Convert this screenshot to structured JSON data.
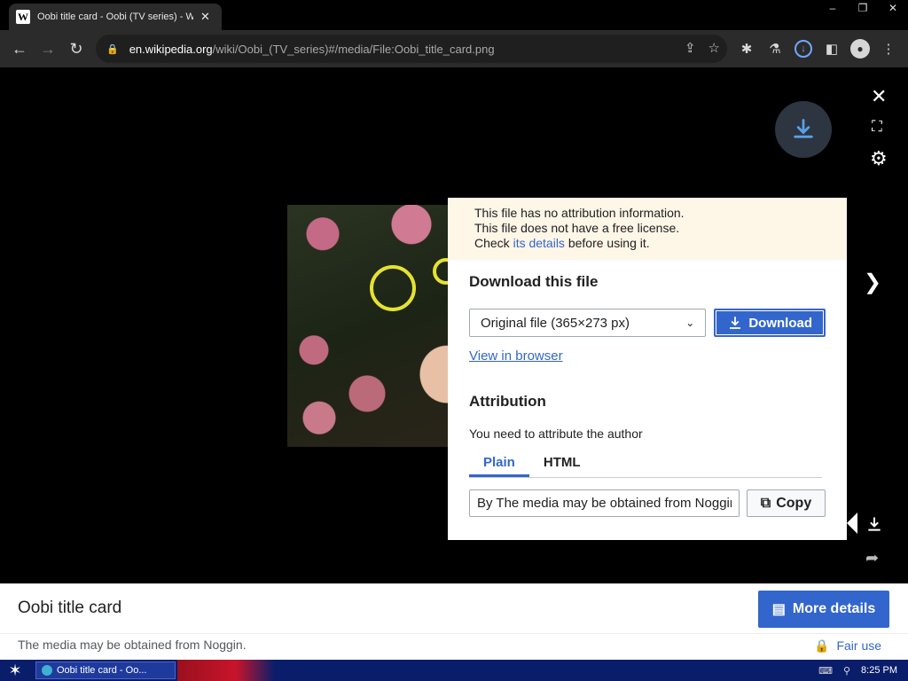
{
  "browser": {
    "tab_title": "Oobi title card - Oobi (TV series) - W",
    "favicon": "W",
    "url_host": "en.wikipedia.org",
    "url_path": "/wiki/Oobi_(TV_series)#/media/File:Oobi_title_card.png",
    "window_controls": [
      "–",
      "❐",
      "✕"
    ]
  },
  "dialog": {
    "notice_line1": "This file has no attribution information.",
    "notice_line2": "This file does not have a free license.",
    "notice_check": "Check ",
    "notice_link": "its details",
    "notice_after": " before using it.",
    "download_heading": "Download this file",
    "size_select_value": "Original file (365×273 px)",
    "download_button": "Download",
    "view_in_browser": "View in browser",
    "attribution_heading": "Attribution",
    "attribution_note": "You need to attribute the author",
    "tabs": [
      "Plain",
      "HTML"
    ],
    "attribution_text": "By The media may be obtained from Noggin",
    "copy_button": "Copy"
  },
  "meta": {
    "title": "Oobi title card",
    "more_details": "More details",
    "description": "The media may be obtained from Noggin.",
    "license": "Fair use"
  },
  "taskbar": {
    "item": "Oobi title card - Oo...",
    "time": "8:25 PM"
  },
  "colors": {
    "accent": "#3366cc",
    "notice_bg": "#fef6e7",
    "taskbar": "#0a1d6b"
  }
}
